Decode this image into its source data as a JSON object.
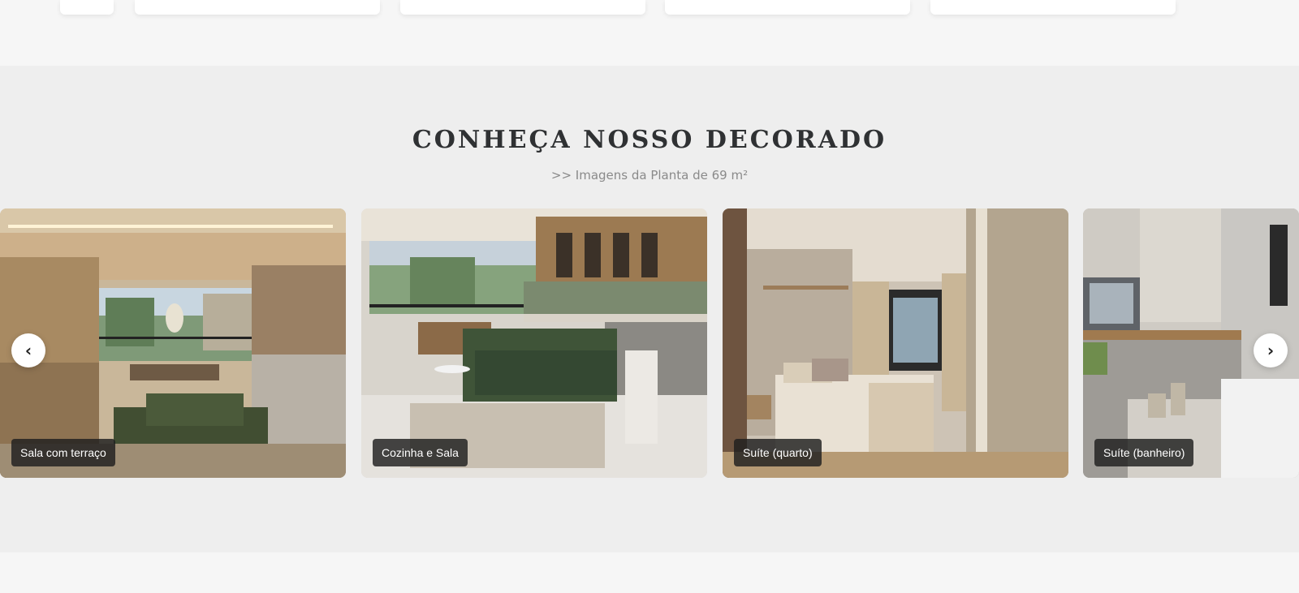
{
  "gallery": {
    "title": "Conheça nosso decorado",
    "subtitle": ">> Imagens da Planta de 69 m²",
    "slides": [
      {
        "caption": "Sala com terraço"
      },
      {
        "caption": "Cozinha e Sala"
      },
      {
        "caption": "Suíte (quarto)"
      },
      {
        "caption": "Suíte (banheiro)"
      }
    ],
    "prev_icon": "‹",
    "next_icon": "›"
  },
  "colors": {
    "section_bg": "#eeeeee",
    "page_bg": "#f6f6f6",
    "title": "#2f3133",
    "caption_bg": "#1e1e1e"
  }
}
